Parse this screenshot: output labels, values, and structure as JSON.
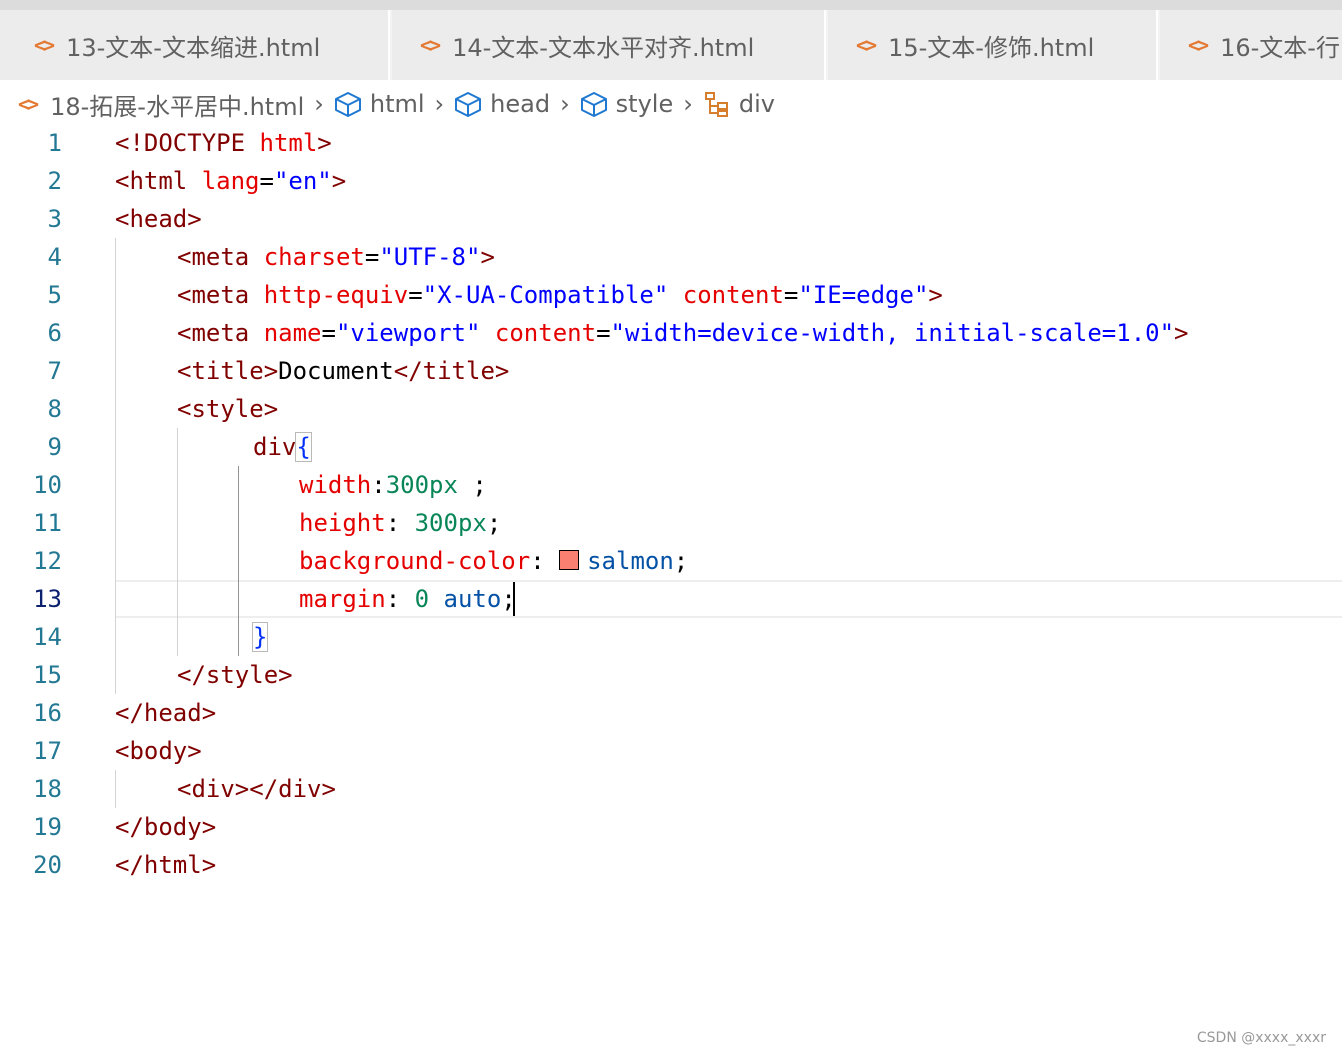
{
  "tabs": [
    {
      "label": "13-文本-文本缩进.html"
    },
    {
      "label": "14-文本-文本水平对齐.html"
    },
    {
      "label": "15-文本-修饰.html"
    },
    {
      "label": "16-文本-行"
    }
  ],
  "file_icon_glyph": "<>",
  "breadcrumb": {
    "file": "18-拓展-水平居中.html",
    "items": [
      "html",
      "head",
      "style",
      "div"
    ]
  },
  "editor": {
    "active_line": 13,
    "line_numbers": [
      "1",
      "2",
      "3",
      "4",
      "5",
      "6",
      "7",
      "8",
      "9",
      "10",
      "11",
      "12",
      "13",
      "14",
      "15",
      "16",
      "17",
      "18",
      "19",
      "20"
    ],
    "lines": {
      "l1": {
        "a": "<!DOCTYPE ",
        "b": "html",
        "c": ">"
      },
      "l2": {
        "a": "<html ",
        "b": "lang",
        "c": "=",
        "d": "\"en\"",
        "e": ">"
      },
      "l3": {
        "a": "<head>"
      },
      "l4": {
        "a": "<meta ",
        "b": "charset",
        "c": "=",
        "d": "\"UTF-8\"",
        "e": ">"
      },
      "l5": {
        "a": "<meta ",
        "b": "http-equiv",
        "c": "=",
        "d": "\"X-UA-Compatible\"",
        "e": " ",
        "f": "content",
        "g": "=",
        "h": "\"IE=edge\"",
        "i": ">"
      },
      "l6": {
        "a": "<meta ",
        "b": "name",
        "c": "=",
        "d": "\"viewport\"",
        "e": " ",
        "f": "content",
        "g": "=",
        "h": "\"width=device-width, initial-scale=1.0\"",
        "i": ">"
      },
      "l7": {
        "a": "<title>",
        "b": "Document",
        "c": "</title>"
      },
      "l8": {
        "a": "<style>"
      },
      "l9": {
        "a": "div",
        "b": "{"
      },
      "l10": {
        "a": "width",
        "b": ":",
        "c": "300px",
        "d": " ;"
      },
      "l11": {
        "a": "height",
        "b": ": ",
        "c": "300px",
        "d": ";"
      },
      "l12": {
        "a": "background-color",
        "b": ": ",
        "c": "salmon",
        "d": ";"
      },
      "l13": {
        "a": "margin",
        "b": ": ",
        "c": "0",
        "d": " ",
        "e": "auto",
        "f": ";"
      },
      "l14": {
        "a": "}"
      },
      "l15": {
        "a": "</style>"
      },
      "l16": {
        "a": "</head>"
      },
      "l17": {
        "a": "<body>"
      },
      "l18": {
        "a": "<div></div>"
      },
      "l19": {
        "a": "</body>"
      },
      "l20": {
        "a": "</html>"
      }
    },
    "swatch_color": "#fa8072"
  },
  "colors": {
    "tag": "#800000",
    "attribute": "#e50000",
    "string": "#0000ff",
    "number": "#098658",
    "value": "#0451a5",
    "line_number": "#237893",
    "file_icon": "#e37933"
  },
  "watermark": "CSDN @xxxx_xxxr"
}
